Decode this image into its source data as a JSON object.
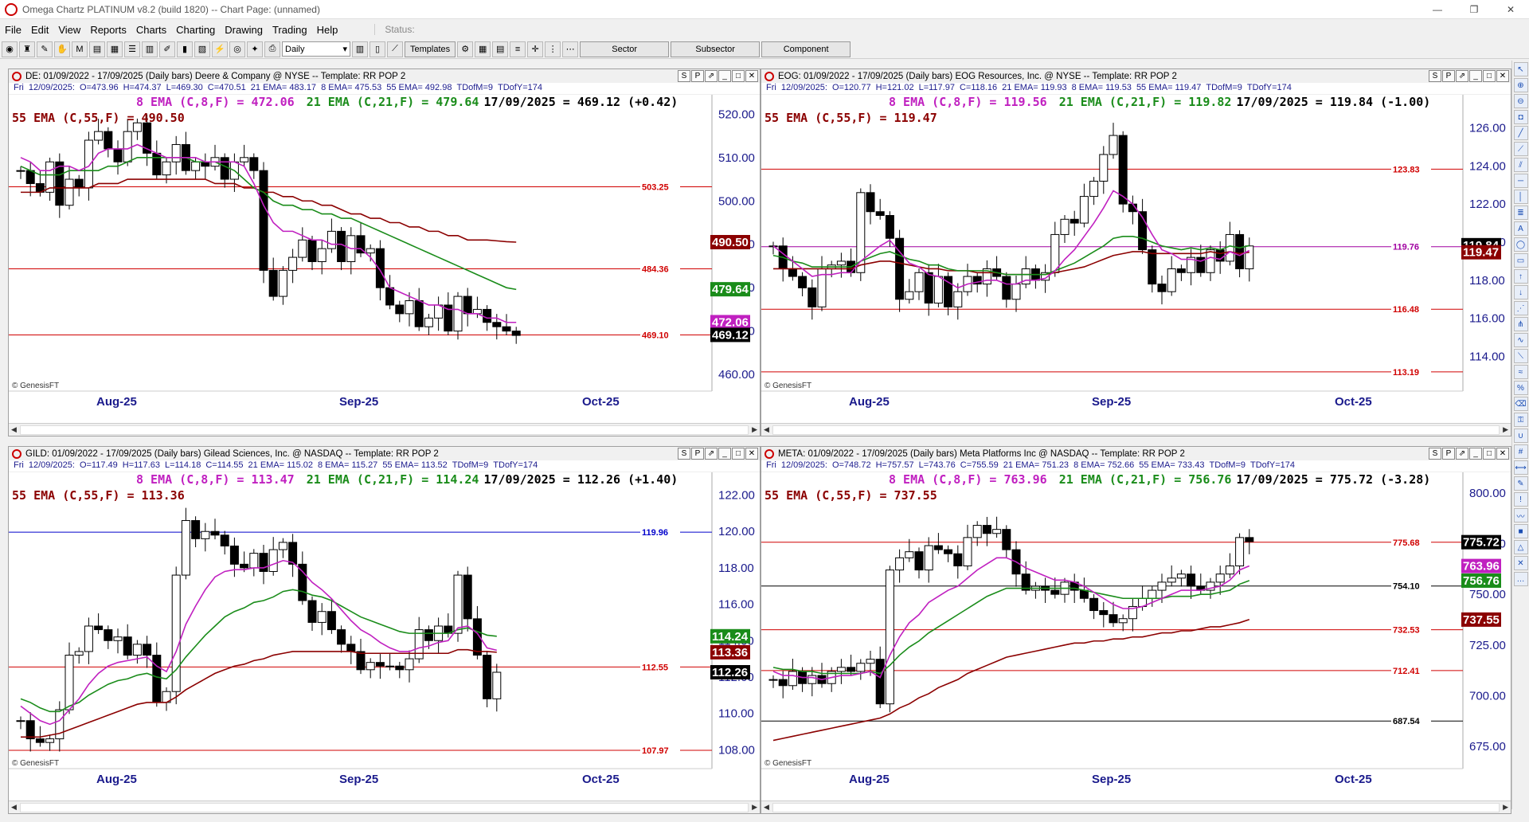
{
  "app": {
    "title": "Omega Chartz PLATINUM v8.2 (build 1820)  --  Chart Page: (unnamed)",
    "window_buttons": [
      "—",
      "❐",
      "✕"
    ]
  },
  "menu": [
    "File",
    "Edit",
    "View",
    "Reports",
    "Charts",
    "Charting",
    "Drawing",
    "Trading",
    "Help"
  ],
  "status_label": "Status:",
  "toolbar": {
    "interval": "Daily",
    "templates": "Templates",
    "sector": "Sector",
    "subsector": "Subsector",
    "component": "Component"
  },
  "months": [
    "Aug-25",
    "Sep-25",
    "Oct-25"
  ],
  "watermark": "© GenesisFT",
  "panes": [
    {
      "header": "DE: 01/09/2022 - 17/09/2025  (Daily bars)   Deere & Company @ NYSE  --  Template: RR POP 2",
      "info": [
        "Fri",
        "12/09/2025:",
        "O=473.96",
        "H=474.37",
        "L=469.30",
        "C=470.51",
        "21 EMA= 483.17",
        "8 EMA= 475.53",
        "55 EMA= 492.98",
        "TDofM=9",
        "TDofY=174"
      ],
      "line1": "8 EMA (C,8,F) = 472.06",
      "line1b": "21 EMA (C,21,F) = 479.64",
      "line1c": "17/09/2025 = 469.12 (+0.42)",
      "line2": "55 EMA (C,55,F) = 490.50",
      "yticks": [
        "520.00",
        "510.00",
        "500.00",
        "490.00",
        "480.00",
        "470.00",
        "460.00"
      ],
      "ymin": 458,
      "ymax": 523,
      "hlines": [
        {
          "v": 503.25,
          "label": "503.25",
          "color": "#d00000"
        },
        {
          "v": 484.36,
          "label": "484.36",
          "color": "#d00000"
        },
        {
          "v": 469.1,
          "label": "469.10",
          "color": "#d00000"
        }
      ],
      "price_tags": [
        {
          "v": 490.5,
          "label": "490.50",
          "bg": "#8b0000"
        },
        {
          "v": 479.64,
          "label": "479.64",
          "bg": "#1a8c1a"
        },
        {
          "v": 472.06,
          "label": "472.06",
          "bg": "#c020c0"
        },
        {
          "v": 469.12,
          "label": "469.12",
          "bg": "#000000"
        }
      ],
      "closes": [
        507,
        504,
        502,
        509,
        499,
        505,
        503,
        514,
        516,
        512,
        509,
        516,
        518,
        511,
        506,
        509,
        513,
        507,
        509,
        508,
        510,
        505,
        509,
        510,
        507,
        484,
        478,
        484,
        487,
        491,
        486,
        489,
        493,
        486,
        492,
        488,
        489,
        480,
        476,
        474,
        477,
        471,
        473,
        476,
        470,
        478,
        474,
        475,
        472,
        471,
        470,
        469
      ],
      "ema8": [
        510,
        509,
        507,
        507,
        508,
        508,
        507,
        508,
        511,
        512,
        512,
        512,
        513,
        512,
        511,
        510,
        510,
        510,
        510,
        509,
        509,
        509,
        509,
        508,
        504,
        499,
        495,
        493,
        493,
        492,
        491,
        491,
        490,
        490,
        489,
        489,
        487,
        484,
        480,
        479,
        478,
        477,
        476,
        476,
        475,
        475,
        474,
        474,
        473,
        473,
        472,
        472
      ],
      "ema21": [
        508,
        507,
        506,
        506,
        506,
        507,
        507,
        507,
        507,
        508,
        508,
        509,
        510,
        510,
        510,
        510,
        510,
        510,
        509,
        509,
        509,
        508,
        507,
        505,
        503,
        502,
        500,
        499,
        499,
        498,
        498,
        497,
        497,
        496,
        496,
        495,
        494,
        493,
        492,
        491,
        490,
        489,
        488,
        487,
        486,
        485,
        484,
        483,
        482,
        481,
        480,
        479.6
      ],
      "ema55": [
        502,
        502,
        502,
        503,
        503,
        503,
        503,
        503,
        504,
        504,
        504,
        505,
        505,
        505,
        505,
        505,
        505,
        505,
        505,
        505,
        504,
        504,
        504,
        503,
        503,
        502,
        502,
        501,
        501,
        500,
        500,
        499,
        499,
        498,
        497,
        497,
        496,
        496,
        495,
        495,
        494,
        494,
        493,
        493,
        492,
        492,
        491,
        491,
        491,
        490.8,
        490.6,
        490.5
      ]
    },
    {
      "header": "EOG: 01/09/2022 - 17/09/2025  (Daily bars)   EOG Resources, Inc. @ NYSE  --  Template: RR POP 2",
      "info": [
        "Fri",
        "12/09/2025:",
        "O=120.77",
        "H=121.02",
        "L=117.97",
        "C=118.16",
        "21 EMA= 119.93",
        "8 EMA= 119.53",
        "55 EMA= 119.47",
        "TDofM=9",
        "TDofY=174"
      ],
      "line1": "8 EMA (C,8,F) = 119.56",
      "line1b": "21 EMA (C,21,F) = 119.82",
      "line1c": "17/09/2025 = 119.84 (-1.00)",
      "line2": "55 EMA (C,55,F) = 119.47",
      "yticks": [
        "126.00",
        "124.00",
        "122.00",
        "120.00",
        "118.00",
        "116.00",
        "114.00"
      ],
      "ymin": 112.6,
      "ymax": 127.4,
      "hlines": [
        {
          "v": 123.83,
          "label": "123.83",
          "color": "#d00000"
        },
        {
          "v": 119.76,
          "label": "119.76",
          "color": "#a000a0"
        },
        {
          "v": 116.48,
          "label": "116.48",
          "color": "#d00000"
        },
        {
          "v": 113.19,
          "label": "113.19",
          "color": "#d00000"
        }
      ],
      "price_tags": [
        {
          "v": 119.84,
          "label": "119.84",
          "bg": "#000000"
        },
        {
          "v": 119.47,
          "label": "119.47",
          "bg": "#8b0000"
        }
      ],
      "closes": [
        119.8,
        118.6,
        118.2,
        117.6,
        116.6,
        118.6,
        118.8,
        119.0,
        118.4,
        122.6,
        121.6,
        121.4,
        120.2,
        117.0,
        117.4,
        118.4,
        116.8,
        118.2,
        116.6,
        117.4,
        118.2,
        117.8,
        118.6,
        118.2,
        117.0,
        117.8,
        118.6,
        118.0,
        118.4,
        120.4,
        121.2,
        121.0,
        122.4,
        123.2,
        124.6,
        125.6,
        122.0,
        121.6,
        119.6,
        117.8,
        117.4,
        118.6,
        118.4,
        119.2,
        118.4,
        119.6,
        119.0,
        120.4,
        118.6,
        119.8
      ],
      "ema8": [
        119.8,
        119.4,
        119.0,
        118.6,
        118.2,
        118.3,
        118.3,
        118.4,
        118.4,
        119.0,
        119.4,
        119.8,
        120.1,
        119.5,
        118.9,
        118.7,
        118.3,
        118.2,
        117.9,
        117.6,
        117.8,
        117.9,
        118.0,
        118.0,
        117.8,
        117.8,
        118.0,
        118.0,
        118.1,
        118.5,
        119.1,
        119.6,
        120.3,
        121.0,
        121.8,
        122.7,
        122.4,
        122.0,
        121.3,
        120.4,
        119.6,
        119.4,
        119.1,
        119.1,
        119.0,
        119.2,
        119.1,
        119.5,
        119.3,
        119.56
      ],
      "ema21": [
        119.3,
        119.2,
        119.0,
        118.9,
        118.7,
        118.7,
        118.7,
        118.7,
        118.7,
        119.0,
        119.2,
        119.4,
        119.5,
        119.3,
        119.1,
        119.0,
        118.8,
        118.8,
        118.6,
        118.5,
        118.5,
        118.5,
        118.5,
        118.4,
        118.3,
        118.3,
        118.3,
        118.3,
        118.3,
        118.5,
        118.7,
        118.9,
        119.2,
        119.5,
        119.8,
        120.2,
        120.3,
        120.3,
        120.2,
        120.0,
        119.8,
        119.7,
        119.6,
        119.7,
        119.6,
        119.7,
        119.6,
        119.8,
        119.7,
        119.82
      ],
      "ema55": [
        118.6,
        118.6,
        118.6,
        118.6,
        118.6,
        118.6,
        118.6,
        118.6,
        118.6,
        118.8,
        118.9,
        119.0,
        119.0,
        118.9,
        118.8,
        118.7,
        118.6,
        118.6,
        118.5,
        118.5,
        118.5,
        118.4,
        118.4,
        118.4,
        118.3,
        118.3,
        118.3,
        118.3,
        118.3,
        118.4,
        118.5,
        118.6,
        118.7,
        118.9,
        119.1,
        119.3,
        119.4,
        119.5,
        119.5,
        119.4,
        119.4,
        119.4,
        119.4,
        119.4,
        119.4,
        119.5,
        119.4,
        119.5,
        119.4,
        119.47
      ]
    },
    {
      "header": "GILD: 01/09/2022 - 17/09/2025  (Daily bars)   Gilead Sciences, Inc. @ NASDAQ  --  Template: RR POP 2",
      "info": [
        "Fri",
        "12/09/2025:",
        "O=117.49",
        "H=117.63",
        "L=114.18",
        "C=114.55",
        "21 EMA= 115.02",
        "8 EMA= 115.27",
        "55 EMA= 113.52",
        "TDofM=9",
        "TDofY=174"
      ],
      "line1": "8 EMA (C,8,F) = 113.47",
      "line1b": "21 EMA (C,21,F) = 114.24",
      "line1c": "17/09/2025 = 112.26 (+1.40)",
      "line2": "55 EMA (C,55,F) = 113.36",
      "yticks": [
        "122.00",
        "120.00",
        "118.00",
        "116.00",
        "114.00",
        "112.00",
        "110.00",
        "108.00"
      ],
      "ymin": 107.4,
      "ymax": 122.9,
      "hlines": [
        {
          "v": 119.96,
          "label": "119.96",
          "color": "#0000cc"
        },
        {
          "v": 112.55,
          "label": "112.55",
          "color": "#d00000"
        },
        {
          "v": 107.97,
          "label": "107.97",
          "color": "#d00000"
        }
      ],
      "price_tags": [
        {
          "v": 114.24,
          "label": "114.24",
          "bg": "#1a8c1a"
        },
        {
          "v": 113.36,
          "label": "113.36",
          "bg": "#8b0000"
        },
        {
          "v": 112.26,
          "label": "112.26",
          "bg": "#000000"
        }
      ],
      "closes": [
        109.6,
        108.6,
        108.4,
        108.6,
        110.2,
        113.2,
        113.4,
        114.8,
        114.6,
        114.0,
        114.2,
        113.2,
        113.8,
        113.2,
        110.6,
        111.2,
        117.6,
        120.6,
        119.6,
        120.0,
        119.8,
        119.2,
        118.2,
        118.0,
        118.8,
        117.8,
        119.0,
        119.4,
        118.2,
        116.2,
        115.0,
        115.6,
        114.6,
        113.8,
        113.4,
        112.4,
        112.8,
        112.6,
        112.6,
        112.4,
        113.0,
        114.6,
        114.0,
        114.8,
        114.4,
        117.6,
        115.2,
        113.2,
        110.8,
        112.26
      ],
      "ema8": [
        110.4,
        110.0,
        109.6,
        109.4,
        109.6,
        110.2,
        110.8,
        111.6,
        112.2,
        112.6,
        112.8,
        112.9,
        113.0,
        113.1,
        112.6,
        112.3,
        113.4,
        114.9,
        115.9,
        116.8,
        117.5,
        117.8,
        117.9,
        117.9,
        118.0,
        118.0,
        118.2,
        118.4,
        118.3,
        117.8,
        117.2,
        116.8,
        116.3,
        115.7,
        115.1,
        114.6,
        114.3,
        113.9,
        113.6,
        113.4,
        113.4,
        113.6,
        113.7,
        113.9,
        114.0,
        114.7,
        114.8,
        114.4,
        113.6,
        113.47
      ],
      "ema21": [
        110.8,
        110.6,
        110.3,
        110.1,
        110.1,
        110.4,
        110.6,
        111.0,
        111.3,
        111.6,
        111.8,
        111.9,
        112.1,
        112.2,
        112.0,
        111.9,
        112.4,
        113.1,
        113.7,
        114.3,
        114.8,
        115.3,
        115.6,
        115.8,
        116.1,
        116.2,
        116.4,
        116.7,
        116.8,
        116.7,
        116.5,
        116.4,
        116.2,
        115.9,
        115.6,
        115.3,
        115.1,
        114.9,
        114.7,
        114.5,
        114.4,
        114.4,
        114.4,
        114.4,
        114.4,
        114.6,
        114.7,
        114.5,
        114.3,
        114.24
      ],
      "ema55": [
        108.7,
        108.7,
        108.7,
        108.8,
        108.9,
        109.1,
        109.3,
        109.5,
        109.7,
        109.9,
        110.1,
        110.3,
        110.5,
        110.6,
        110.6,
        110.6,
        110.9,
        111.3,
        111.6,
        111.9,
        112.2,
        112.4,
        112.6,
        112.7,
        112.9,
        113.0,
        113.2,
        113.3,
        113.4,
        113.4,
        113.4,
        113.4,
        113.4,
        113.4,
        113.4,
        113.3,
        113.3,
        113.3,
        113.3,
        113.3,
        113.3,
        113.3,
        113.3,
        113.3,
        113.3,
        113.5,
        113.5,
        113.4,
        113.4,
        113.36
      ]
    },
    {
      "header": "META: 01/09/2022 - 17/09/2025  (Daily bars)   Meta Platforms Inc @ NASDAQ  --  Template: RR POP 2",
      "info": [
        "Fri",
        "12/09/2025:",
        "O=748.72",
        "H=757.57",
        "L=743.76",
        "C=755.59",
        "21 EMA= 751.23",
        "8 EMA= 752.66",
        "55 EMA= 733.43",
        "TDofM=9",
        "TDofY=174"
      ],
      "line1": "8 EMA (C,8,F) = 763.96",
      "line1b": "21 EMA (C,21,F) = 756.76",
      "line1c": "17/09/2025 = 775.72 (-3.28)",
      "line2": "55 EMA (C,55,F) = 737.55",
      "yticks": [
        "800.00",
        "775.00",
        "750.00",
        "725.00",
        "700.00",
        "675.00"
      ],
      "ymin": 668,
      "ymax": 807,
      "hlines": [
        {
          "v": 775.68,
          "label": "775.68",
          "color": "#d00000"
        },
        {
          "v": 754.1,
          "label": "754.10",
          "color": "#000000"
        },
        {
          "v": 732.53,
          "label": "732.53",
          "color": "#d00000"
        },
        {
          "v": 712.41,
          "label": "712.41",
          "color": "#d00000"
        },
        {
          "v": 687.54,
          "label": "687.54",
          "color": "#000000"
        }
      ],
      "price_tags": [
        {
          "v": 775.72,
          "label": "775.72",
          "bg": "#000000"
        },
        {
          "v": 763.96,
          "label": "763.96",
          "bg": "#c020c0"
        },
        {
          "v": 756.76,
          "label": "756.76",
          "bg": "#1a8c1a"
        },
        {
          "v": 737.55,
          "label": "737.55",
          "bg": "#8b0000"
        }
      ],
      "closes": [
        708,
        705,
        712,
        706,
        710,
        706,
        712,
        714,
        712,
        716,
        718,
        696,
        762,
        768,
        771,
        762,
        774,
        772,
        770,
        764,
        778,
        784,
        780,
        782,
        772,
        760,
        752,
        754,
        752,
        750,
        756,
        752,
        748,
        742,
        740,
        736,
        738,
        744,
        748,
        752,
        756,
        758,
        760,
        754,
        752,
        756,
        760,
        764,
        778,
        776
      ],
      "ema8": [
        712,
        710,
        710,
        709,
        709,
        708,
        709,
        710,
        710,
        711,
        712,
        709,
        720,
        729,
        736,
        740,
        746,
        749,
        752,
        754,
        758,
        762,
        765,
        768,
        768,
        766,
        763,
        761,
        759,
        757,
        757,
        756,
        754,
        751,
        748,
        745,
        743,
        743,
        744,
        746,
        748,
        750,
        752,
        752,
        752,
        753,
        754,
        757,
        762,
        764
      ],
      "ema21": [
        714,
        713,
        713,
        712,
        712,
        711,
        711,
        711,
        711,
        711,
        712,
        711,
        715,
        720,
        724,
        727,
        731,
        734,
        737,
        740,
        743,
        746,
        749,
        751,
        753,
        753,
        753,
        753,
        753,
        753,
        753,
        753,
        752,
        751,
        750,
        749,
        748,
        748,
        748,
        748,
        748,
        749,
        749,
        749,
        750,
        750,
        751,
        752,
        755,
        756.8
      ],
      "ema55": [
        678,
        679,
        680,
        681,
        682,
        683,
        684,
        685,
        686,
        687,
        688,
        689,
        691,
        694,
        696,
        699,
        701,
        704,
        706,
        708,
        711,
        713,
        715,
        717,
        719,
        720,
        721,
        722,
        723,
        724,
        725,
        726,
        726,
        727,
        727,
        728,
        728,
        729,
        729,
        730,
        731,
        731,
        732,
        732,
        733,
        734,
        734,
        735,
        736,
        737.6
      ]
    }
  ]
}
